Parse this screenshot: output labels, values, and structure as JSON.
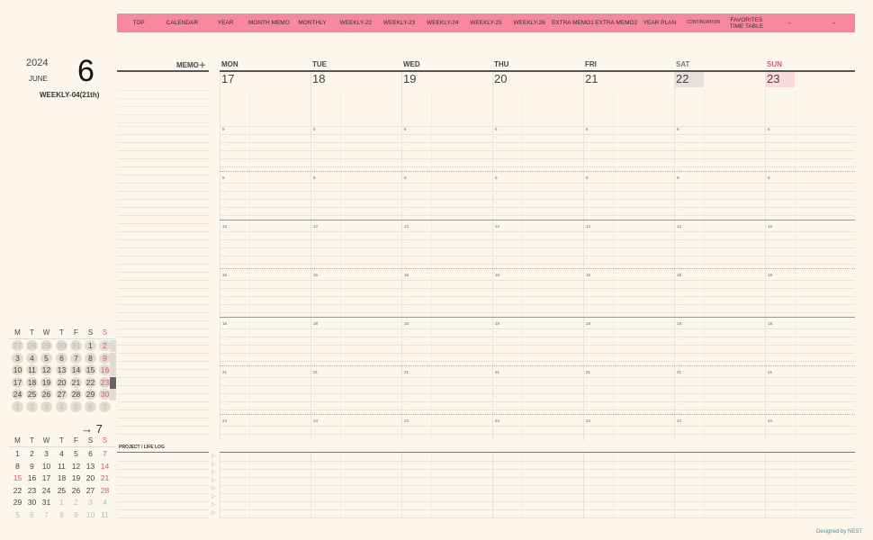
{
  "nav": [
    "TOP",
    "CALENDAR",
    "YEAR",
    "MONTH MEMO",
    "MONTHLY",
    "WEEKLY-22",
    "WEEKLY-23",
    "WEEKLY-24",
    "WEEKLY-25",
    "WEEKLY-26",
    "EXTRA MEMO1",
    "EXTRA MEMO2",
    "YEAR PLAN",
    "CONTINUATION",
    "FAVORITES TIME TABLE",
    "←",
    "→"
  ],
  "header": {
    "year": "2024",
    "month": "JUNE",
    "month_num": "6",
    "weekly": "WEEKLY-04(21th)",
    "memo": "MEMO＋"
  },
  "days": [
    {
      "name": "MON",
      "date": "17"
    },
    {
      "name": "TUE",
      "date": "18"
    },
    {
      "name": "WED",
      "date": "19"
    },
    {
      "name": "THU",
      "date": "20"
    },
    {
      "name": "FRI",
      "date": "21"
    },
    {
      "name": "SAT",
      "date": "22"
    },
    {
      "name": "SUN",
      "date": "23"
    }
  ],
  "hours": [
    "6",
    "9",
    "12",
    "15",
    "18",
    "21",
    "24"
  ],
  "project_label": "PROJECT / LIFE LOG",
  "mini_june": {
    "dow": [
      "M",
      "T",
      "W",
      "T",
      "F",
      "S",
      "S"
    ],
    "weeks": [
      [
        "27",
        "28",
        "29",
        "30",
        "31",
        "1",
        "2"
      ],
      [
        "3",
        "4",
        "5",
        "6",
        "7",
        "8",
        "9"
      ],
      [
        "10",
        "11",
        "12",
        "13",
        "14",
        "15",
        "16"
      ],
      [
        "17",
        "18",
        "19",
        "20",
        "21",
        "22",
        "23"
      ],
      [
        "24",
        "25",
        "26",
        "27",
        "28",
        "29",
        "30"
      ],
      [
        "1",
        "2",
        "3",
        "4",
        "5",
        "6",
        "7"
      ]
    ]
  },
  "mini_july": {
    "title": "→ 7",
    "dow": [
      "M",
      "T",
      "W",
      "T",
      "F",
      "S",
      "S"
    ],
    "weeks": [
      [
        "1",
        "2",
        "3",
        "4",
        "5",
        "6",
        "7"
      ],
      [
        "8",
        "9",
        "10",
        "11",
        "12",
        "13",
        "14"
      ],
      [
        "15",
        "16",
        "17",
        "18",
        "19",
        "20",
        "21"
      ],
      [
        "22",
        "23",
        "24",
        "25",
        "26",
        "27",
        "28"
      ],
      [
        "29",
        "30",
        "31",
        "1",
        "2",
        "3",
        "4"
      ],
      [
        "5",
        "6",
        "7",
        "8",
        "9",
        "10",
        "11"
      ]
    ]
  },
  "footer": "Designed by NEST",
  "colors": {
    "nav": "#f7899e",
    "sunday": "#d45a78",
    "today_sat": "#e4e0da",
    "today_sun": "#fbd9dc"
  }
}
